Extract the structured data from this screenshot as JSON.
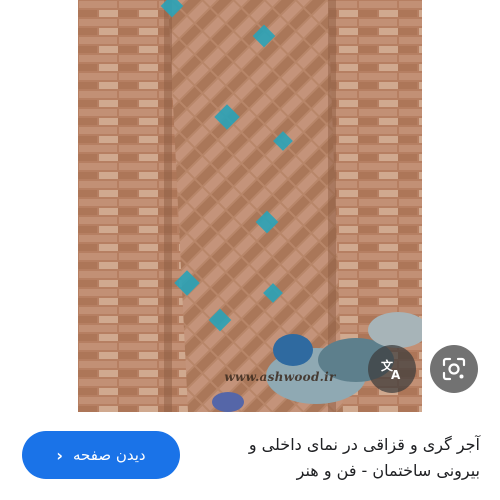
{
  "image": {
    "watermark": "www.ashwood.ir"
  },
  "overlay": {
    "translate_icon": "translate-icon",
    "lens_icon": "lens-icon"
  },
  "result": {
    "visit_label": "دیدن صفحه",
    "title_line1": "آجر گری و قزاقی در نمای داخلی و",
    "title_line2": "بیرونی ساختمان - فن و هنر"
  },
  "colors": {
    "accent": "#1a73e8",
    "brick": "#b9876b",
    "tile": "#2aa3b8"
  }
}
